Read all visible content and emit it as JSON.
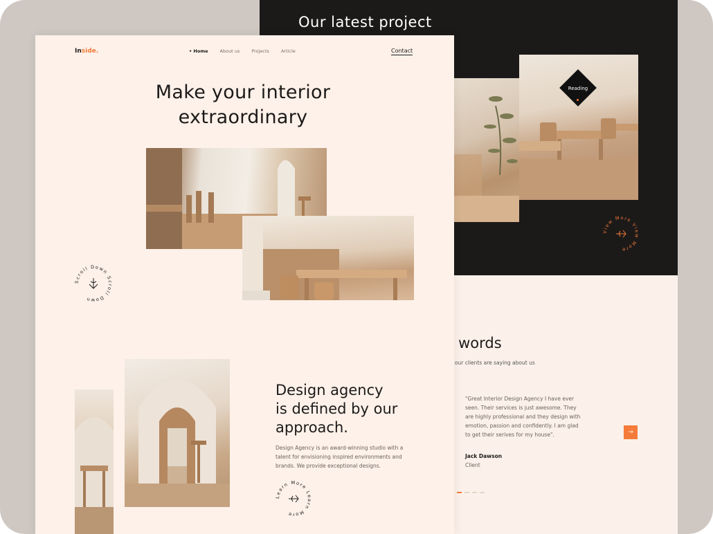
{
  "back_page": {
    "latest_title": "Our latest project",
    "reading_label": "Reading",
    "view_more_text": "View More View More",
    "words_title": "v words",
    "words_sub": "at our clients are saying about us",
    "quote": "\"Great Interior Design Agency I have ever seen. Their services is just awesome. They are highly professional and they design with emotion, passion and confidently. I am glad to get their serives for my house\".",
    "client_name": "Jack Dawson",
    "client_role": "Client",
    "next_icon": "→"
  },
  "front_page": {
    "logo_main": "In",
    "logo_accent": "side.",
    "nav": [
      "• Home",
      "About us",
      "Projects",
      "Article"
    ],
    "contact": "Contact",
    "hero_line1": "Make your interior",
    "hero_line2": "extraordinary",
    "scroll_text": "Scroll Down Scroll Down",
    "agency_line1": "Design agency",
    "agency_line2": "is defined by our",
    "agency_line3": "approach.",
    "agency_text": "Design Agency is an award-winning studio with a talent for envisioning inspired environments and brands. We provide exceptional designs.",
    "learn_text": "Learn More Learn More"
  },
  "colors": {
    "accent": "#f47b39",
    "dark": "#1c1a19",
    "cream": "#fdf1e9",
    "outer": "#cfc8c2"
  }
}
